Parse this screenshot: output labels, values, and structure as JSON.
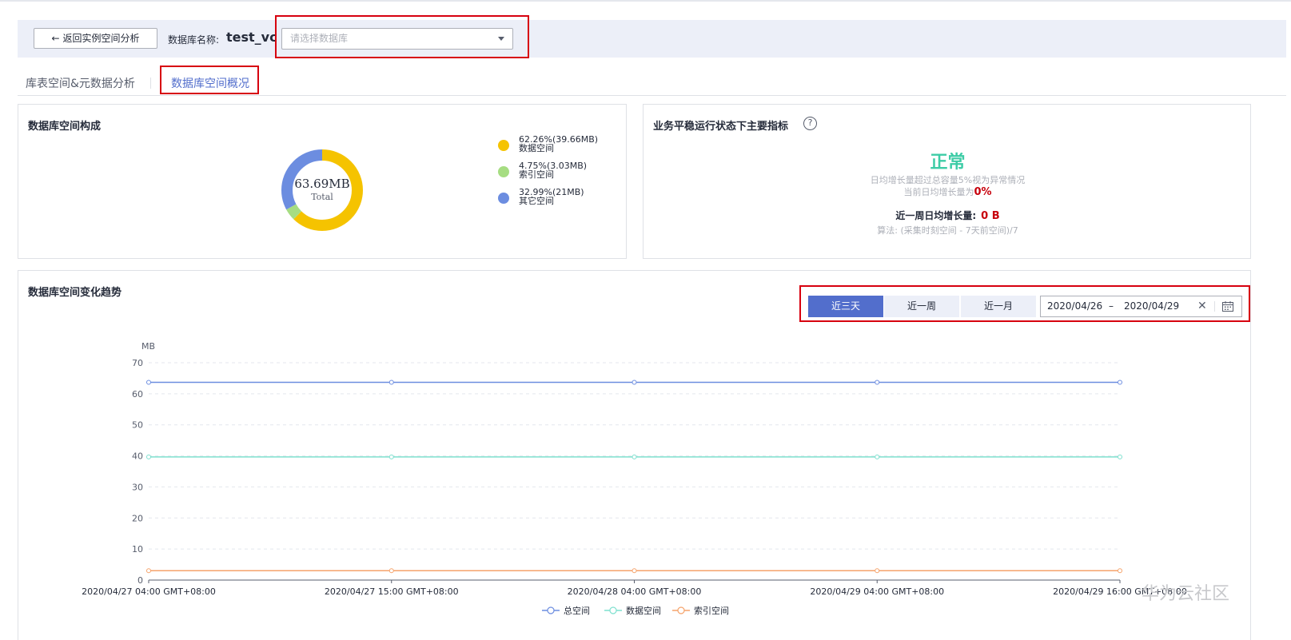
{
  "header": {
    "back_button": "返回实例空间分析",
    "db_name_label": "数据库名称:",
    "db_name": "test_vc",
    "db_select_placeholder": "请选择数据库"
  },
  "tabs": [
    {
      "label": "库表空间&元数据分析",
      "active": false
    },
    {
      "label": "数据库空间概况",
      "active": true
    }
  ],
  "composition": {
    "title": "数据库空间构成",
    "total_value": "63.69MB",
    "total_label": "Total",
    "legend": [
      {
        "line1": "62.26%(39.66MB)",
        "line2": "数据空间",
        "percent": 62.26,
        "color": "#f5c300"
      },
      {
        "line1": "4.75%(3.03MB)",
        "line2": "索引空间",
        "percent": 4.75,
        "color": "#a6dd82"
      },
      {
        "line1": "32.99%(21MB)",
        "line2": "其它空间",
        "percent": 32.99,
        "color": "#6c8de0"
      }
    ]
  },
  "metrics": {
    "title": "业务平稳运行状态下主要指标",
    "help_icon": "?",
    "status": "正常",
    "rule_text": "日均增长量超过总容量5%视为异常情况",
    "current_prefix": "当前日均增长量为",
    "current_value": "0%",
    "avg_label": "近一周日均增长量:",
    "avg_value": "0 B",
    "formula": "算法: (采集时刻空间 - 7天前空间)/7"
  },
  "trend": {
    "title": "数据库空间变化趋势",
    "range_buttons": [
      {
        "label": "近三天",
        "active": true
      },
      {
        "label": "近一周",
        "active": false
      },
      {
        "label": "近一月",
        "active": false
      }
    ],
    "date_start": "2020/04/26",
    "date_sep": "–",
    "date_end": "2020/04/29",
    "clear_icon": "✕"
  },
  "chart_data": {
    "type": "line",
    "ylabel": "MB",
    "ylim": [
      0,
      70
    ],
    "yticks": [
      0,
      10,
      20,
      30,
      40,
      50,
      60,
      70
    ],
    "grid": true,
    "legend_position": "bottom",
    "x": [
      "2020/04/27 04:00 GMT+08:00",
      "2020/04/27 15:00 GMT+08:00",
      "2020/04/28 04:00 GMT+08:00",
      "2020/04/29 04:00 GMT+08:00",
      "2020/04/29 16:00 GMT+08:00"
    ],
    "series": [
      {
        "name": "总空间",
        "color": "#6c8de0",
        "values": [
          63.69,
          63.69,
          63.69,
          63.69,
          63.69
        ]
      },
      {
        "name": "数据空间",
        "color": "#7fe0cf",
        "values": [
          39.66,
          39.66,
          39.66,
          39.66,
          39.66
        ]
      },
      {
        "name": "索引空间",
        "color": "#f5a36b",
        "values": [
          3.03,
          3.03,
          3.03,
          3.03,
          3.03
        ]
      }
    ]
  },
  "watermark": "华为云社区"
}
